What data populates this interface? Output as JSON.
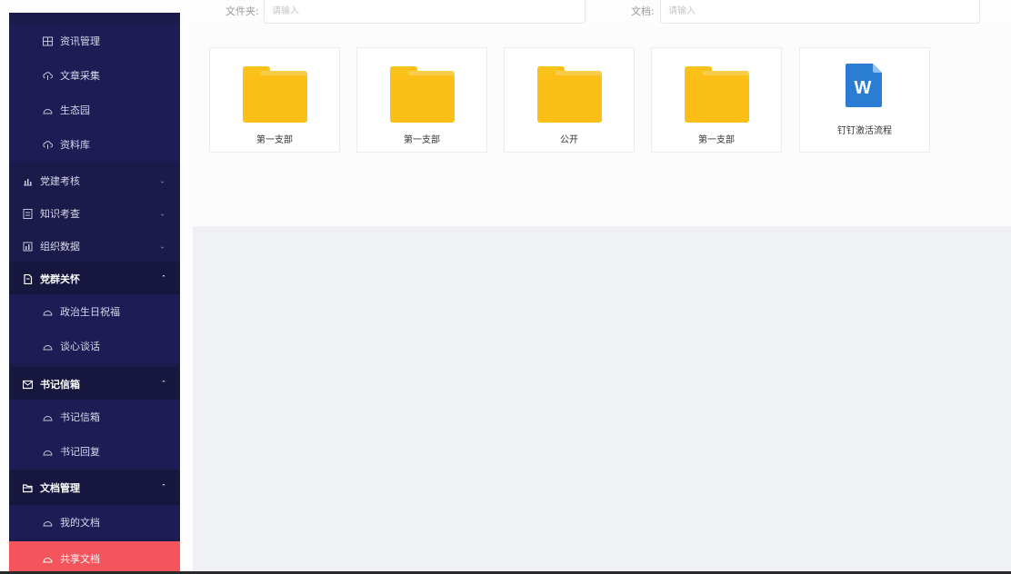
{
  "sidebar": {
    "items": [
      {
        "label": "资讯管理",
        "icon": "grid-icon",
        "type": "child"
      },
      {
        "label": "文章采集",
        "icon": "upload-cloud-icon",
        "type": "child"
      },
      {
        "label": "生态园",
        "icon": "circle-icon",
        "type": "child"
      },
      {
        "label": "资料库",
        "icon": "upload-cloud-icon",
        "type": "child"
      },
      {
        "label": "党建考核",
        "icon": "bar-chart-icon",
        "type": "parent",
        "expanded": false
      },
      {
        "label": "知识考查",
        "icon": "checklist-icon",
        "type": "parent",
        "expanded": false
      },
      {
        "label": "组织数据",
        "icon": "column-chart-icon",
        "type": "parent",
        "expanded": false
      },
      {
        "label": "党群关怀",
        "icon": "document-icon",
        "type": "parent",
        "expanded": true
      },
      {
        "label": "政治生日祝福",
        "icon": "circle-icon",
        "type": "child"
      },
      {
        "label": "谈心谈话",
        "icon": "circle-icon",
        "type": "child"
      },
      {
        "label": "书记信箱",
        "icon": "mail-icon",
        "type": "parent",
        "expanded": true
      },
      {
        "label": "书记信箱",
        "icon": "circle-icon",
        "type": "child"
      },
      {
        "label": "书记回复",
        "icon": "circle-icon",
        "type": "child"
      },
      {
        "label": "文档管理",
        "icon": "folder-open-icon",
        "type": "parent",
        "expanded": true
      },
      {
        "label": "我的文档",
        "icon": "circle-icon",
        "type": "child"
      },
      {
        "label": "共享文档",
        "icon": "circle-icon",
        "type": "child",
        "active": true
      }
    ]
  },
  "filters": {
    "folder_label": "文件夹:",
    "folder_placeholder": "请输入",
    "doc_label": "文档:",
    "doc_placeholder": "请输入"
  },
  "files": [
    {
      "name": "第一支部",
      "kind": "folder"
    },
    {
      "name": "第一支部",
      "kind": "folder"
    },
    {
      "name": "公开",
      "kind": "folder"
    },
    {
      "name": "第一支部",
      "kind": "folder"
    },
    {
      "name": "钉钉激活流程",
      "kind": "word-document",
      "badge": "W"
    }
  ],
  "colors": {
    "sidebar_bg": "#1b1a4b",
    "active_item": "#f4545c",
    "folder": "#fcbf17",
    "word_blue": "#2b7cd3",
    "content_gray": "#f0f1f4"
  }
}
